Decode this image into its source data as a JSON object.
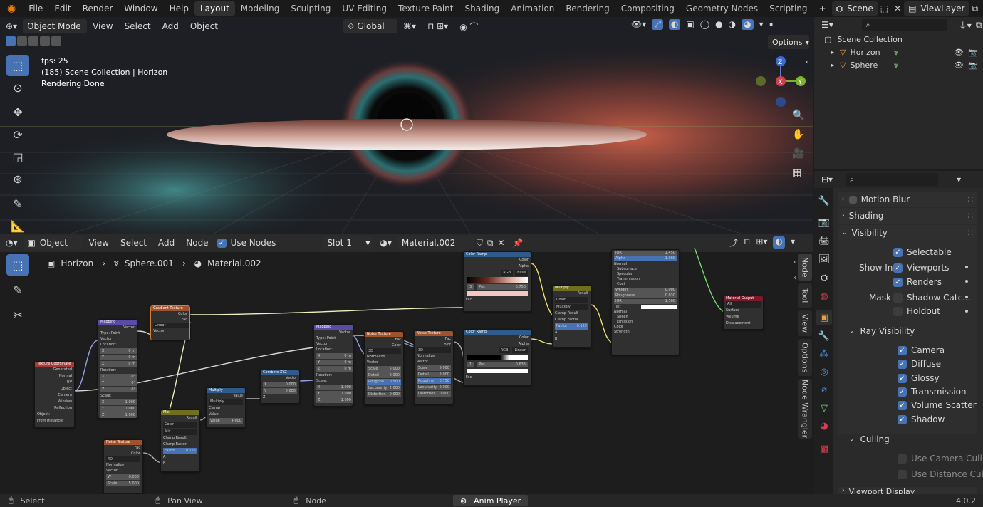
{
  "menu": [
    "File",
    "Edit",
    "Render",
    "Window",
    "Help"
  ],
  "workspaces": [
    "Layout",
    "Modeling",
    "Sculpting",
    "UV Editing",
    "Texture Paint",
    "Shading",
    "Animation",
    "Rendering",
    "Compositing",
    "Geometry Nodes",
    "Scripting"
  ],
  "active_workspace": "Layout",
  "scene_name": "Scene",
  "view_layer": "ViewLayer",
  "viewport": {
    "mode": "Object Mode",
    "menus": [
      "View",
      "Select",
      "Add",
      "Object"
    ],
    "orientation": "Global",
    "options_label": "Options",
    "overlay": [
      "fps: 25",
      "(185) Scene Collection | Horizon",
      "Rendering Done"
    ],
    "gizmo": {
      "z": "Z",
      "x": "X",
      "y": "Y"
    }
  },
  "outliner": {
    "root": "Scene Collection",
    "items": [
      {
        "label": "Horizon"
      },
      {
        "label": "Sphere"
      }
    ]
  },
  "properties": {
    "panels": {
      "motion_blur": "Motion Blur",
      "shading": "Shading",
      "visibility": "Visibility",
      "ray_visibility": "Ray Visibility",
      "culling": "Culling",
      "viewport_display": "Viewport Display"
    },
    "selectable": "Selectable",
    "show_in_label": "Show In",
    "viewports": "Viewports",
    "renders": "Renders",
    "mask_label": "Mask",
    "shadow_catcher": "Shadow Catc...",
    "holdout": "Holdout",
    "ray": [
      "Camera",
      "Diffuse",
      "Glossy",
      "Transmission",
      "Volume Scatter",
      "Shadow"
    ],
    "use_camera_cull": "Use Camera Cull",
    "use_distance_cull": "Use Distance Cull"
  },
  "node_editor": {
    "type": "Object",
    "menus": [
      "View",
      "Select",
      "Add",
      "Node"
    ],
    "use_nodes": "Use Nodes",
    "slot": "Slot 1",
    "material": "Material.002",
    "breadcrumb": [
      "Horizon",
      "Sphere.001",
      "Material.002"
    ],
    "side_tabs": [
      "Node",
      "Tool",
      "View",
      "Options",
      "Node Wrangler"
    ],
    "nodes": {
      "tex_coord": {
        "title": "Texture Coordinate",
        "rows": [
          "Generated",
          "Normal",
          "UV",
          "Object",
          "Camera",
          "Window",
          "Reflection",
          "Object:",
          "From Instancer"
        ]
      },
      "mapping1": {
        "title": "Mapping",
        "rows": [
          "Vector",
          "Type:",
          "Point",
          "Vector",
          "Location:",
          "X",
          "0 m",
          "Y",
          "0 m",
          "Z",
          "0 m",
          "Rotation:",
          "X",
          "0°",
          "Y",
          "0°",
          "Z",
          "0°",
          "Scale:",
          "X",
          "1.000",
          "Y",
          "1.000",
          "Z",
          "1.000"
        ]
      },
      "gradient": {
        "title": "Gradient Texture",
        "rows": [
          "Color",
          "Fac",
          "Linear",
          "Vector"
        ]
      },
      "mix": {
        "title": "Mix",
        "rows": [
          "Result",
          "Color",
          "Mix",
          "Clamp Result",
          "Clamp Factor",
          "Factor",
          "0.125",
          "A",
          "B"
        ]
      },
      "multiply1": {
        "title": "Multiply",
        "rows": [
          "Value",
          "Multiply",
          "Clamp",
          "Value",
          "Value",
          "4.000"
        ]
      },
      "combine": {
        "title": "Combine XYZ",
        "rows": [
          "Vector",
          "X",
          "0.000",
          "Y",
          "0.000",
          "Z"
        ]
      },
      "mapping2": {
        "title": "Mapping",
        "rows": [
          "Vector",
          "Type:",
          "Point",
          "Vector",
          "Location:",
          "X",
          "0 m",
          "Y",
          "0 m",
          "Z",
          "0 m",
          "Rotation:",
          "Scale:",
          "X",
          "1.000",
          "Y",
          "1.000",
          "Z",
          "1.000"
        ]
      },
      "noise1": {
        "title": "Noise Texture",
        "rows": [
          "Fac",
          "Color",
          "3D",
          "Normalize",
          "Vector",
          "Scale",
          "5.000",
          "Detail",
          "2.000",
          "Roughne",
          "0.500",
          "Lacunarity",
          "2.000",
          "Distortion",
          "0.000"
        ]
      },
      "noise2": {
        "title": "Noise Texture",
        "rows": [
          "Fac",
          "Color",
          "3D",
          "Normalize",
          "Vector",
          "Scale",
          "5.000",
          "Detail",
          "2.000",
          "Roughne",
          "0.750",
          "Lacunarity",
          "2.000",
          "Distortion",
          "0.000"
        ]
      },
      "noise3": {
        "title": "Noise Texture",
        "rows": [
          "Fac",
          "Color",
          "4D",
          "Normalize",
          "Vector",
          "W",
          "0.000",
          "Scale",
          "5.000"
        ]
      },
      "ramp1": {
        "title": "Color Ramp",
        "rows": [
          "Color",
          "Alpha",
          "RGB",
          "Ease",
          "3",
          "Pos",
          "0.750",
          "Fac"
        ]
      },
      "ramp2": {
        "title": "Color Ramp",
        "rows": [
          "Color",
          "Alpha",
          "RGB",
          "Linear",
          "1",
          "Pos",
          "0.636",
          "Fac"
        ]
      },
      "multiply2": {
        "title": "Multiply",
        "rows": [
          "Result",
          "Color",
          "Multiply",
          "Clamp Result",
          "Clamp Factor",
          "Factor",
          "0.125",
          "A",
          "B"
        ]
      },
      "bsdf": {
        "rows": [
          "IOR",
          "1.450",
          "Alpha",
          "1.000",
          "Normal",
          "Subsurface",
          "Specular",
          "Transmission",
          "Coat",
          "Weight",
          "0.000",
          "Roughness",
          "0.030",
          "IOR",
          "1.500",
          "Tint",
          "Normal",
          "Sheen",
          "Emission",
          "Color",
          "Strength"
        ]
      },
      "output": {
        "title": "Material Output",
        "rows": [
          "All",
          "Surface",
          "Volume",
          "Displacement"
        ]
      }
    }
  },
  "statusbar": {
    "select": "Select",
    "pan": "Pan View",
    "node": "Node",
    "anim": "Anim Player",
    "version": "4.0.2"
  }
}
